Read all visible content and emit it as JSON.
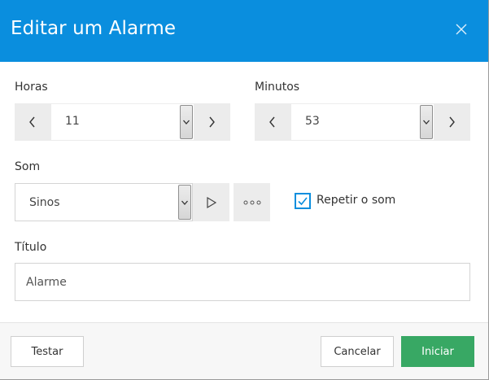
{
  "dialog": {
    "title": "Editar um Alarme",
    "accent_color": "#0a8ede",
    "close_icon": "close-icon"
  },
  "hours": {
    "label": "Horas",
    "value": "11",
    "prev_icon": "chevron-left-icon",
    "next_icon": "chevron-right-icon"
  },
  "minutes": {
    "label": "Minutos",
    "value": "53",
    "prev_icon": "chevron-left-icon",
    "next_icon": "chevron-right-icon"
  },
  "sound": {
    "label": "Som",
    "value": "Sinos",
    "play_icon": "play-icon",
    "more_icon": "more-options-icon",
    "repeat": {
      "label": "Repetir o som",
      "checked": true
    }
  },
  "title_field": {
    "label": "Título",
    "value": "Alarme"
  },
  "footer": {
    "test_label": "Testar",
    "cancel_label": "Cancelar",
    "start_label": "Iniciar",
    "start_color": "#38a864"
  }
}
